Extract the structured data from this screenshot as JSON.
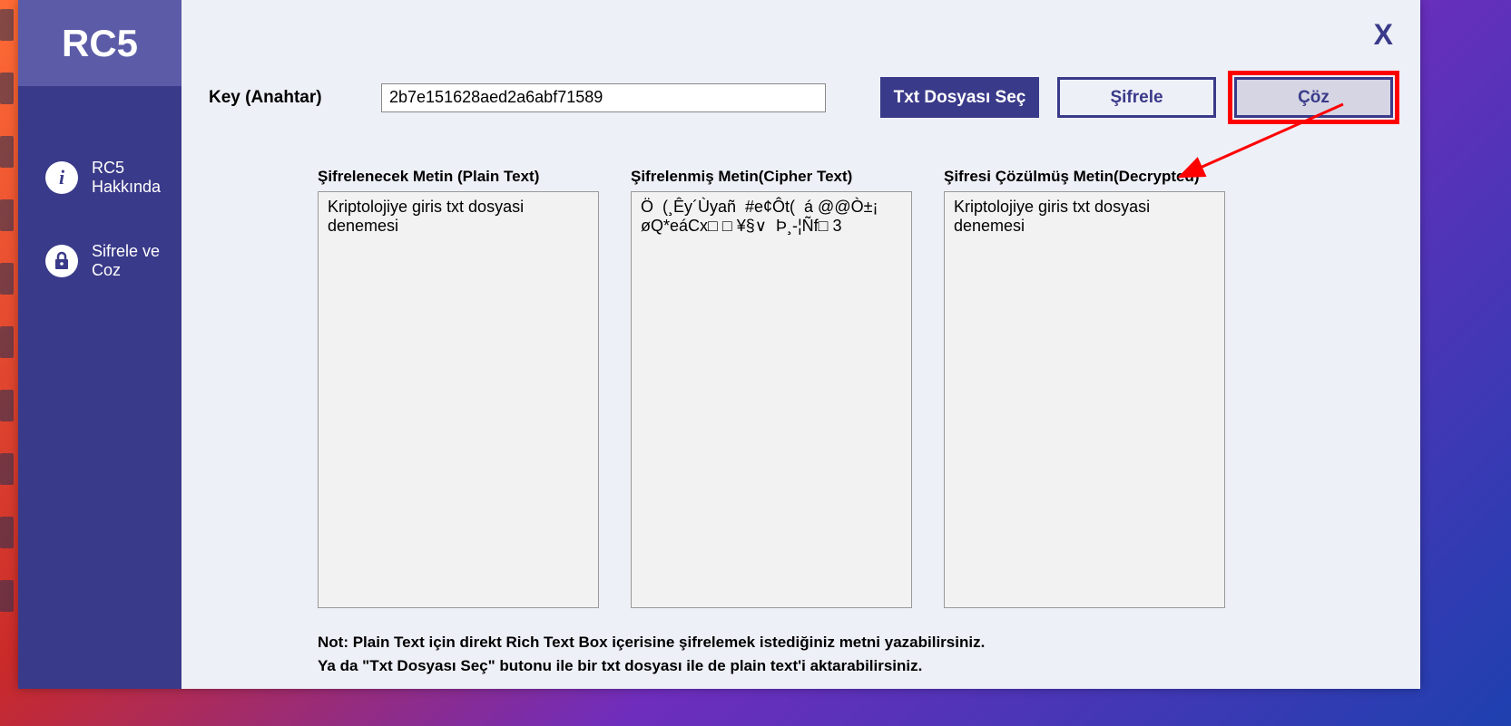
{
  "sidebar": {
    "title": "RC5",
    "items": [
      {
        "label": "RC5 Hakkında",
        "icon": "info-icon"
      },
      {
        "label": "Sifrele ve Coz",
        "icon": "lock-icon"
      }
    ]
  },
  "header": {
    "close_label": "X"
  },
  "key": {
    "label": "Key (Anahtar)",
    "value": "2b7e151628aed2a6abf71589"
  },
  "buttons": {
    "select_txt": "Txt Dosyası Seç",
    "encrypt": "Şifrele",
    "decrypt": "Çöz"
  },
  "panels": {
    "plain": {
      "label": "Şifrelenecek Metin (Plain Text)",
      "value": "Kriptolojiye giris txt dosyasi denemesi"
    },
    "cipher": {
      "label": "Şifrelenmiş Metin(Cipher Text)",
      "value": "Ö  (¸Êy´Ùyañ  #e¢Ôt(  á @@Ò±¡  øQ*eáCx□ □ ¥§∨  Þ¸-¦Ñf□ 3"
    },
    "decrypted": {
      "label": "Şifresi Çözülmüş Metin(Decrypted)",
      "value": "Kriptolojiye giris txt dosyasi denemesi"
    }
  },
  "note": {
    "line1": "Not: Plain Text için direkt Rich Text Box içerisine şifrelemek istediğiniz metni yazabilirsiniz.",
    "line2": "Ya da \"Txt Dosyası Seç\" butonu ile bir txt dosyası ile de plain text'i aktarabilirsiniz."
  }
}
